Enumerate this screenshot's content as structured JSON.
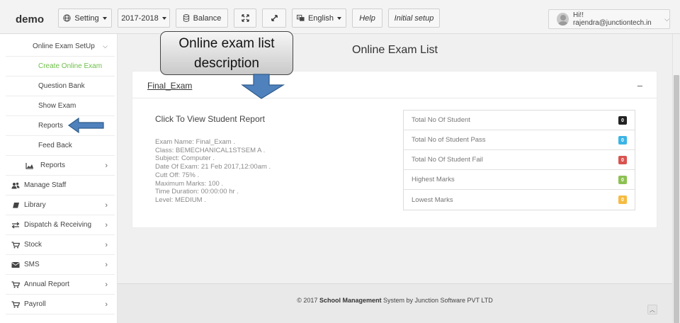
{
  "navbar": {
    "brand": "demo",
    "setting_label": "Setting",
    "year_label": "2017-2018",
    "balance_label": "Balance",
    "language_label": "English",
    "help_label": "Help",
    "initial_setup_label": "Initial setup",
    "user_label": "Hi!! rajendra@junctiontech.in"
  },
  "sidebar": {
    "items": [
      {
        "label": "Online Exam SetUp",
        "icon": "chevron-down-icon"
      },
      {
        "label": "Create Online Exam"
      },
      {
        "label": "Question Bank"
      },
      {
        "label": "Show Exam"
      },
      {
        "label": "Reports"
      },
      {
        "label": "Feed Back"
      },
      {
        "label": "Reports",
        "icon": "area-chart-icon"
      },
      {
        "label": "Manage Staff",
        "icon": "users-icon"
      },
      {
        "label": "Library",
        "icon": "book-icon"
      },
      {
        "label": "Dispatch & Receiving",
        "icon": "exchange-icon"
      },
      {
        "label": "Stock",
        "icon": "cart-icon"
      },
      {
        "label": "SMS",
        "icon": "envelope-icon"
      },
      {
        "label": "Annual Report",
        "icon": "cart-icon"
      },
      {
        "label": "Payroll",
        "icon": "cart-icon"
      }
    ],
    "active_color": "#6fbf4b"
  },
  "main": {
    "page_title": "Online Exam List",
    "exam_name_link": "Final_Exam",
    "collapse_symbol": "–",
    "report_title": "Click To View Student Report",
    "details": [
      "Exam Name: Final_Exam .",
      "Class: BEMECHANICAL1STSEM A .",
      "Subject: Computer .",
      "Date Of Exam: 21 Feb 2017,12:00am .",
      "Cutt Off: 75% .",
      "Maximum Marks: 100 .",
      "Time Duration: 00:00:00 hr .",
      "Level: MEDIUM ."
    ],
    "stats": [
      {
        "label": "Total No Of Student",
        "value": "0",
        "color": "#222222"
      },
      {
        "label": "Total No of Student Pass",
        "value": "0",
        "color": "#3bb4e5"
      },
      {
        "label": "Total No Of Student Fail",
        "value": "0",
        "color": "#d9534f"
      },
      {
        "label": "Highest Marks",
        "value": "0",
        "color": "#8cc152"
      },
      {
        "label": "Lowest Marks",
        "value": "0",
        "color": "#f6bb42"
      }
    ]
  },
  "footer": {
    "prefix": "© 2017",
    "bold": "School Management",
    "suffix": "System by Junction Software PVT LTD"
  },
  "annotation": {
    "line1": "Online exam list",
    "line2": "description",
    "arrow_color": "#4f81bd"
  }
}
